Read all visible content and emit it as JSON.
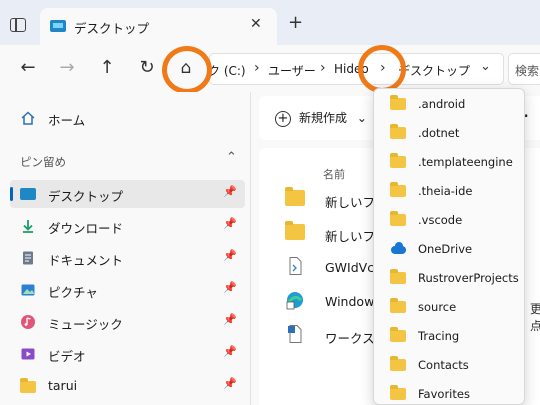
{
  "tab": {
    "title": "デスクトップ",
    "close": "✕",
    "new_tab": "+"
  },
  "nav": {
    "back": "←",
    "forward": "→",
    "up": "↑",
    "refresh": "↻",
    "home": "⌂"
  },
  "address": {
    "crumbs": [
      "ク (C:)",
      "ユーザー",
      "Hideo",
      "デスクトップ"
    ],
    "separator": "›",
    "dropdown": "⌄"
  },
  "search": {
    "placeholder": "検索"
  },
  "sidebar": {
    "home": "ホーム",
    "section": "ピン留め",
    "section_caret": "⌃",
    "pin": "📌",
    "items": [
      {
        "label": "デスクトップ",
        "icon": "desktop-icon",
        "color": "#1e88c7"
      },
      {
        "label": "ダウンロード",
        "icon": "download-icon",
        "color": "#1a9c6c"
      },
      {
        "label": "ドキュメント",
        "icon": "documents-icon",
        "color": "#6d7a8c"
      },
      {
        "label": "ピクチャ",
        "icon": "pictures-icon",
        "color": "#2f7fd6"
      },
      {
        "label": "ミュージック",
        "icon": "music-icon",
        "color": "#e0567a"
      },
      {
        "label": "ビデオ",
        "icon": "videos-icon",
        "color": "#8a4bc8"
      },
      {
        "label": "tarui",
        "icon": "folder-icon",
        "color": "#f4c542"
      }
    ]
  },
  "toolbar": {
    "new_label": "新規作成",
    "new_caret": "⌄",
    "more": "·"
  },
  "files": {
    "column_name": "名前",
    "rows": [
      {
        "name": "新しいフォ",
        "icon": "folder-icon"
      },
      {
        "name": "新しいフォ",
        "icon": "folder-icon"
      },
      {
        "name": "GWIdVc",
        "icon": "file-icon"
      },
      {
        "name": "Window",
        "icon": "edge-shortcut-icon"
      },
      {
        "name": "ワークスペ",
        "icon": "workspace-icon"
      }
    ],
    "right_fragment": "更点"
  },
  "dropdown": {
    "items": [
      {
        "label": ".android",
        "icon": "folder-icon"
      },
      {
        "label": ".dotnet",
        "icon": "folder-icon"
      },
      {
        "label": ".templateengine",
        "icon": "folder-icon"
      },
      {
        "label": ".theia-ide",
        "icon": "folder-icon"
      },
      {
        "label": ".vscode",
        "icon": "folder-icon"
      },
      {
        "label": "OneDrive",
        "icon": "onedrive-icon"
      },
      {
        "label": "RustroverProjects",
        "icon": "folder-icon"
      },
      {
        "label": "source",
        "icon": "folder-icon"
      },
      {
        "label": "Tracing",
        "icon": "folder-icon"
      },
      {
        "label": "Contacts",
        "icon": "folder-icon"
      },
      {
        "label": "Favorites",
        "icon": "folder-icon"
      }
    ]
  },
  "colors": {
    "highlight": "#f07a18",
    "accent": "#0067c0",
    "folder": "#f4c542"
  }
}
